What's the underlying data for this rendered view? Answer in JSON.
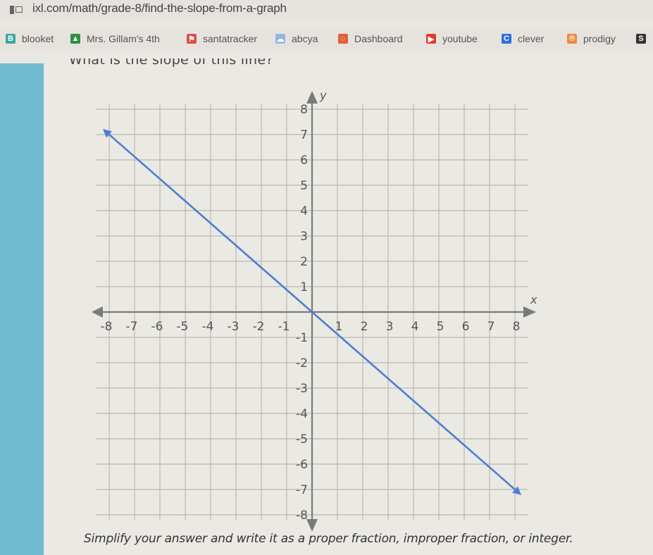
{
  "browser": {
    "url": "ixl.com/math/grade-8/find-the-slope-from-a-graph",
    "bookmarks": [
      {
        "label": "blooket",
        "icon": "blooket-icon",
        "color": "#3aa99f",
        "glyph": "B"
      },
      {
        "label": "Mrs. Gillam's 4th",
        "icon": "google-classroom-icon",
        "color": "#2f8f3e",
        "glyph": "▲"
      },
      {
        "label": "santatracker",
        "icon": "santatracker-icon",
        "color": "#e24b4b",
        "glyph": "⚑"
      },
      {
        "label": "abcya",
        "icon": "abcya-icon",
        "color": "#8fb7e0",
        "glyph": "☁"
      },
      {
        "label": "Dashboard",
        "icon": "dashboard-icon",
        "color": "#e0603a",
        "glyph": "◌"
      },
      {
        "label": "youtube",
        "icon": "youtube-icon",
        "color": "#e33b2e",
        "glyph": "▶"
      },
      {
        "label": "clever",
        "icon": "clever-icon",
        "color": "#2f6fe0",
        "glyph": "C"
      },
      {
        "label": "prodigy",
        "icon": "prodigy-icon",
        "color": "#f08a3c",
        "glyph": "℗"
      },
      {
        "label": "",
        "icon": "s-bookmark-icon",
        "color": "#333333",
        "glyph": "S"
      }
    ]
  },
  "problem": {
    "question": "What is the slope of this line?",
    "instructions": "Simplify your answer and write it as a proper fraction, improper fraction, or integer."
  },
  "chart_data": {
    "type": "line",
    "title": "",
    "xlabel": "x",
    "ylabel": "y",
    "xlim": [
      -8,
      8
    ],
    "ylim": [
      -8,
      8
    ],
    "x_ticks": [
      -8,
      -7,
      -6,
      -5,
      -4,
      -3,
      -2,
      -1,
      1,
      2,
      3,
      4,
      5,
      6,
      7,
      8
    ],
    "y_ticks": [
      -8,
      -7,
      -6,
      -5,
      -4,
      -3,
      -2,
      -1,
      1,
      2,
      3,
      4,
      5,
      6,
      7,
      8
    ],
    "grid": true,
    "series": [
      {
        "name": "line",
        "color": "#4a7fd0",
        "points": [
          [
            -8,
            7
          ],
          [
            0,
            0
          ],
          [
            8,
            -7
          ]
        ],
        "arrows": "both"
      }
    ]
  }
}
